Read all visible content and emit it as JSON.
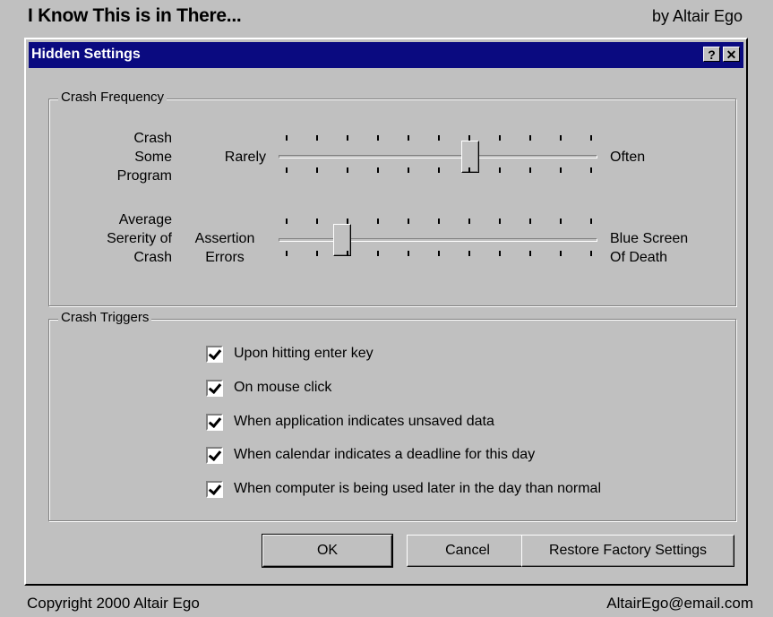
{
  "comic": {
    "title": "I Know This is in There...",
    "byline": "by Altair Ego",
    "copyright": "Copyright 2000 Altair Ego",
    "email": "AltairEgo@email.com"
  },
  "dialog": {
    "title": "Hidden Settings",
    "help_label": "?",
    "close_label": "✕"
  },
  "crash_frequency": {
    "legend": "Crash Frequency",
    "sliders": [
      {
        "label": "Crash\nSome\nProgram",
        "left_label": "Rarely",
        "right_label": "Often",
        "value": 0.6
      },
      {
        "label": "Average\nSererity of\nCrash",
        "left_label": "Assertion\nErrors",
        "right_label": "Blue Screen\nOf Death",
        "value": 0.2
      }
    ]
  },
  "crash_triggers": {
    "legend": "Crash Triggers",
    "items": [
      {
        "label": "Upon hitting enter key",
        "checked": true
      },
      {
        "label": "On mouse click",
        "checked": true
      },
      {
        "label": "When application indicates unsaved data",
        "checked": true
      },
      {
        "label": "When calendar indicates a deadline for this day",
        "checked": true
      },
      {
        "label": "When computer is being used later in the day than normal",
        "checked": true
      }
    ]
  },
  "buttons": {
    "ok": "OK",
    "cancel": "Cancel",
    "restore": "Restore Factory Settings"
  }
}
